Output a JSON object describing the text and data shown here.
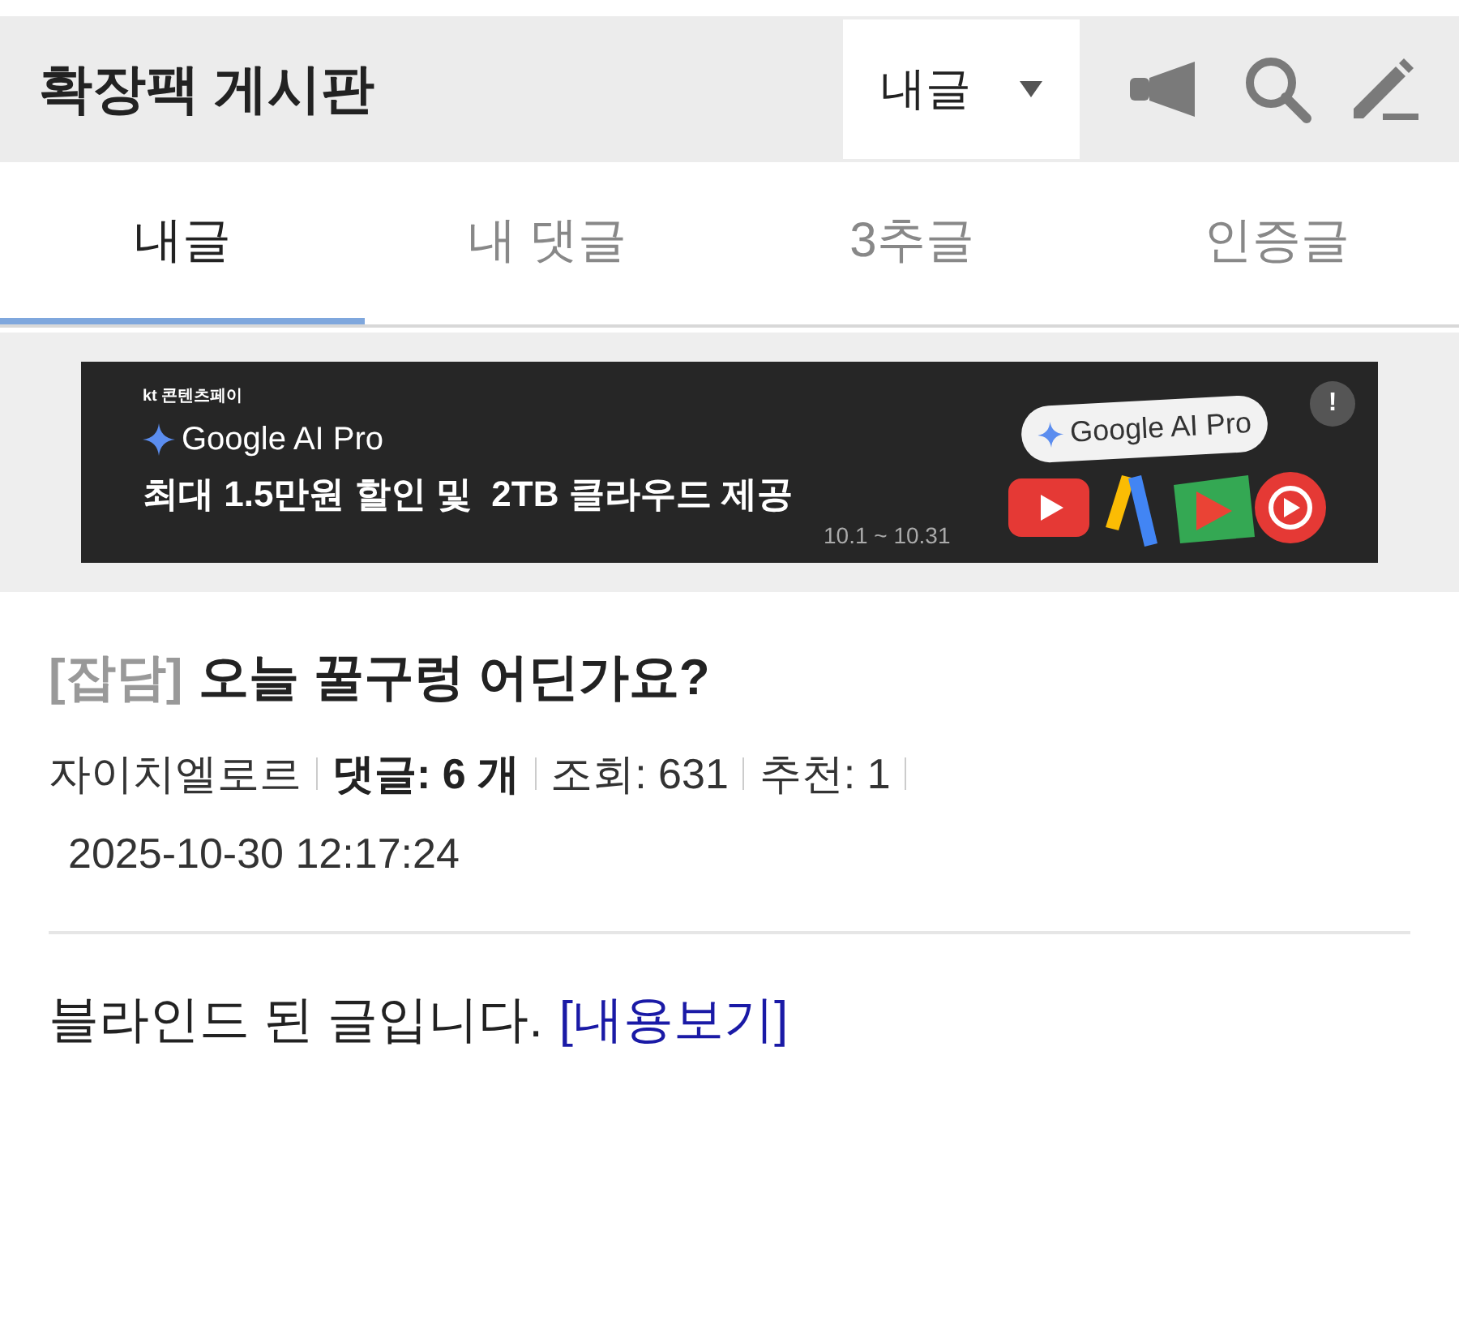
{
  "header": {
    "title": "확장팩 게시판",
    "filter": {
      "label": "내글"
    }
  },
  "tabs": [
    {
      "label": "내글",
      "selected": true
    },
    {
      "label": "내 댓글",
      "selected": false
    },
    {
      "label": "3추글",
      "selected": false
    },
    {
      "label": "인증글",
      "selected": false
    }
  ],
  "ad_banner": {
    "brand": "kt 콘텐츠페이",
    "product": "Google AI Pro",
    "headline": "최대 1.5만원 할인 및  2TB 클라우드 제공",
    "period": "10.1 ~ 10.31",
    "pill": "Google AI Pro",
    "info": "!"
  },
  "post": {
    "category": "[잡담]",
    "title": "오늘 꿀구렁 어딘가요?",
    "meta": [
      {
        "kind": "plain",
        "text": "자이치엘로르"
      },
      {
        "kind": "bold",
        "text": "댓글: 6 개"
      },
      {
        "kind": "plain",
        "text": "조회: 631"
      },
      {
        "kind": "plain",
        "text": "추천: 1"
      }
    ],
    "date": "2025-10-30 12:17:24",
    "body": "블라인드 된 글입니다.",
    "link": "[내용보기]"
  }
}
